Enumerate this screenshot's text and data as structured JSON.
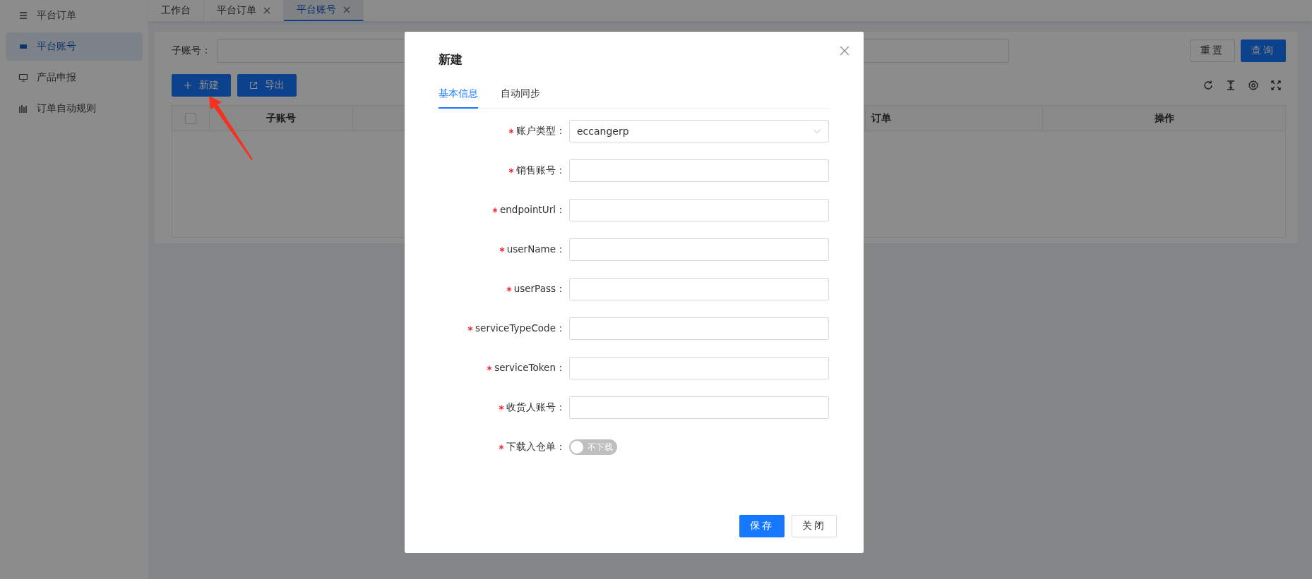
{
  "sidebar": {
    "items": [
      {
        "label": "平台订单",
        "selected": false
      },
      {
        "label": "平台账号",
        "selected": true
      },
      {
        "label": "产品申报",
        "selected": false
      },
      {
        "label": "订单自动规则",
        "selected": false
      }
    ]
  },
  "tabs": [
    {
      "label": "工作台",
      "closable": false,
      "selected": false
    },
    {
      "label": "平台订单",
      "closable": true,
      "selected": false
    },
    {
      "label": "平台账号",
      "closable": true,
      "selected": true
    }
  ],
  "filter": {
    "label": "子账号：",
    "buttons": [
      {
        "label": "重置",
        "kind": "default"
      },
      {
        "label": "查询",
        "kind": "primary"
      }
    ]
  },
  "actions": [
    {
      "label": "新建",
      "kind": "add"
    },
    {
      "label": "导出",
      "kind": "export"
    }
  ],
  "table": {
    "select_all_checked": false,
    "columns": [
      {
        "label": "子账号"
      },
      {
        "label": "订单"
      },
      {
        "label": "操作"
      }
    ]
  },
  "modal": {
    "title": "新建",
    "tabs": [
      {
        "label": "基本信息",
        "selected": true
      },
      {
        "label": "自动同步",
        "selected": false
      }
    ],
    "fields": [
      {
        "kind": "select",
        "required": true,
        "label": "账户类型：",
        "value": "eccangerp"
      },
      {
        "kind": "text",
        "required": true,
        "label": "销售账号："
      },
      {
        "kind": "text",
        "required": true,
        "label": "endpointUrl："
      },
      {
        "kind": "text",
        "required": true,
        "label": "userName："
      },
      {
        "kind": "text",
        "required": true,
        "label": "userPass："
      },
      {
        "kind": "text",
        "required": true,
        "label": "serviceTypeCode："
      },
      {
        "kind": "text",
        "required": true,
        "label": "serviceToken："
      },
      {
        "kind": "text",
        "required": true,
        "label": "收货人账号："
      },
      {
        "kind": "switch",
        "required": true,
        "label": "下载入仓单：",
        "on": false,
        "text": "不下载"
      }
    ],
    "buttons": [
      {
        "label": "保存",
        "kind": "primary"
      },
      {
        "label": "关闭",
        "kind": "default"
      }
    ]
  }
}
